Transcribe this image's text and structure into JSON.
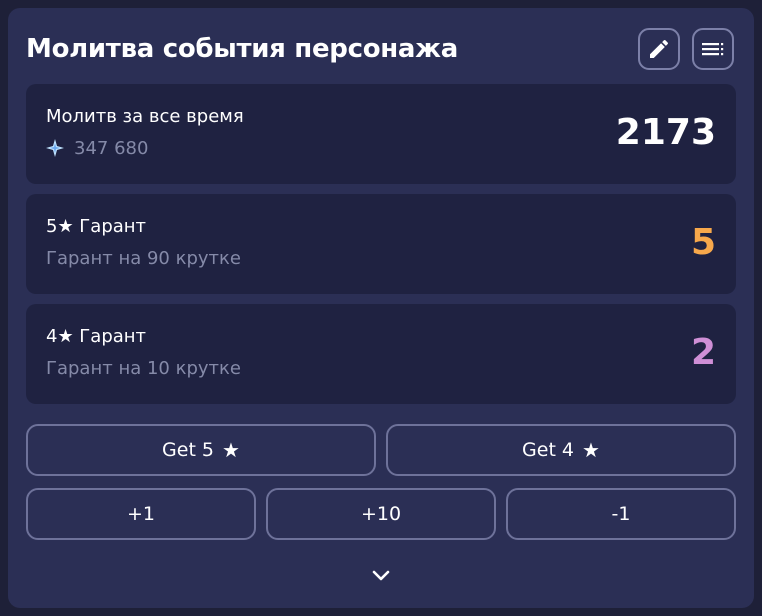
{
  "header": {
    "title": "Молитва события персонажа",
    "edit_icon": "pencil-icon",
    "menu_icon": "list-menu-icon"
  },
  "stats": [
    {
      "label": "Молитв за все время",
      "sub": "347 680",
      "sub_icon": "primogem-icon",
      "value": "2173",
      "value_color": "#ffffff"
    },
    {
      "label": "5★ Гарант",
      "sub": "Гарант на 90 крутке",
      "value": "5",
      "value_color": "#f7a84b"
    },
    {
      "label": "4★ Гарант",
      "sub": "Гарант на 10 крутке",
      "value": "2",
      "value_color": "#cf8fd6"
    }
  ],
  "actions": {
    "get5_label": "Get 5",
    "get4_label": "Get 4",
    "star_glyph": "★",
    "plus1_label": "+1",
    "plus10_label": "+10",
    "minus1_label": "-1"
  },
  "expand_icon": "chevron-down-icon"
}
